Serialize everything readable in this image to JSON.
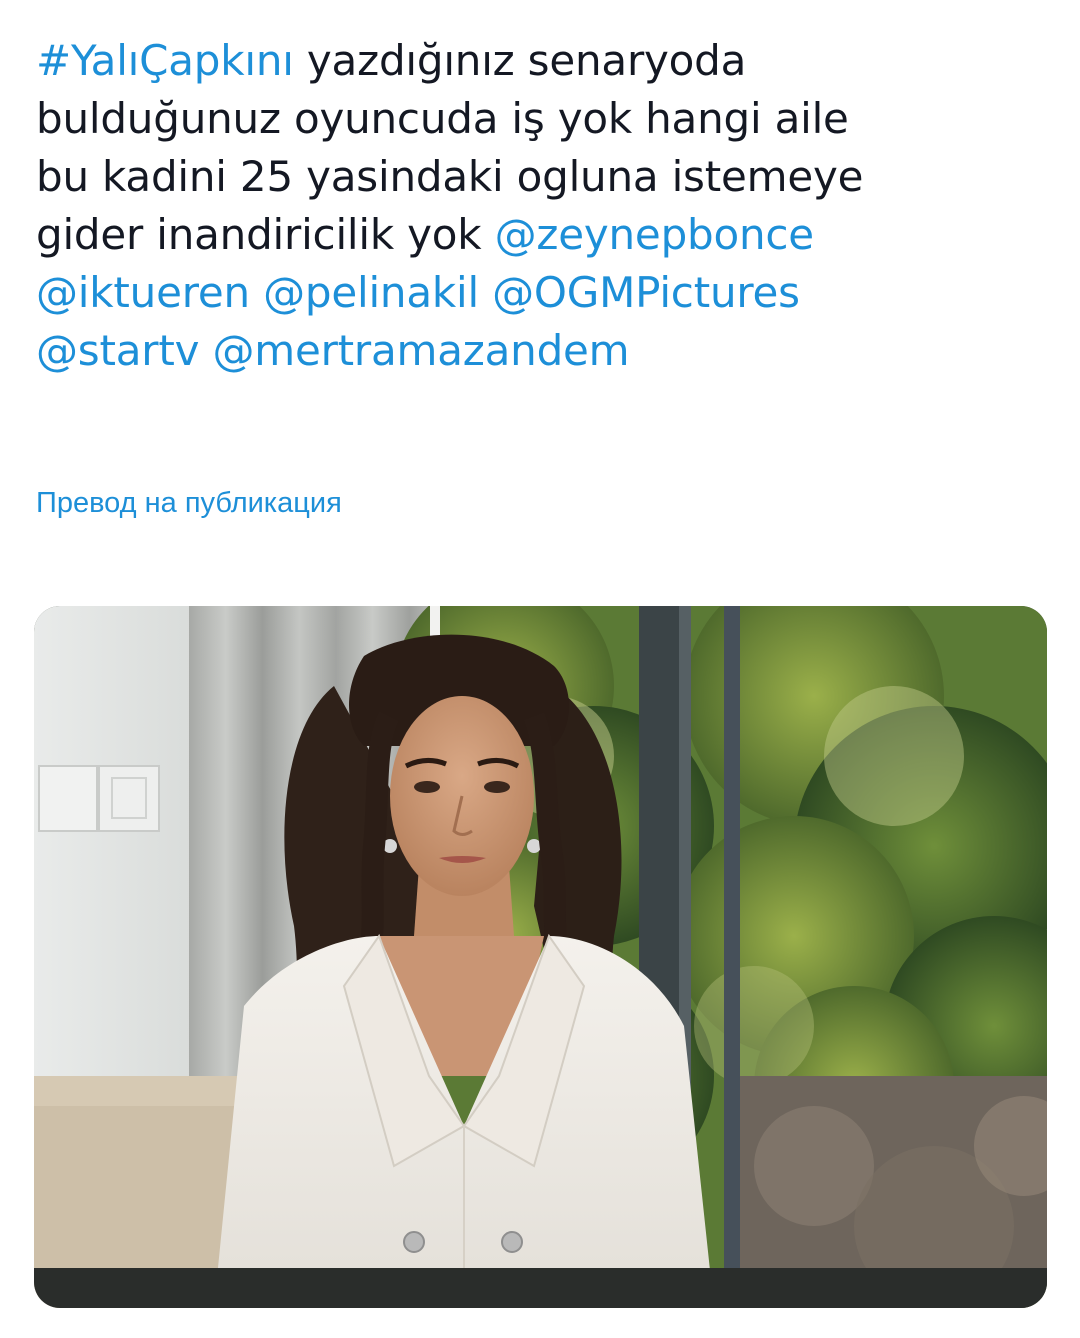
{
  "tweet": {
    "lines": [
      [
        {
          "text": "#YalıÇapkını",
          "link": true
        },
        {
          "text": " yazdığınız senaryoda",
          "link": false
        }
      ],
      [
        {
          "text": "bulduğunuz oyuncuda iş yok hangi  aile",
          "link": false
        }
      ],
      [
        {
          "text": "bu kadini 25 yasindaki ogluna istemeye",
          "link": false
        }
      ],
      [
        {
          "text": "gider inandiricilik yok ",
          "link": false
        },
        {
          "text": "@zeynepbonce",
          "link": true
        }
      ],
      [
        {
          "text": "@iktueren",
          "link": true
        },
        {
          "text": " ",
          "link": false
        },
        {
          "text": "@pelinakil",
          "link": true
        },
        {
          "text": " ",
          "link": false
        },
        {
          "text": "@OGMPictures",
          "link": true
        }
      ],
      [
        {
          "text": "@startv",
          "link": true
        },
        {
          "text": " ",
          "link": false
        },
        {
          "text": "@mertramazandem",
          "link": true
        }
      ]
    ]
  },
  "translate": {
    "label": "Превод на публикация"
  },
  "colors": {
    "text": "#141823",
    "link": "#1d8fd8",
    "background": "#ffffff"
  },
  "media": {
    "icon": "photo-icon"
  }
}
